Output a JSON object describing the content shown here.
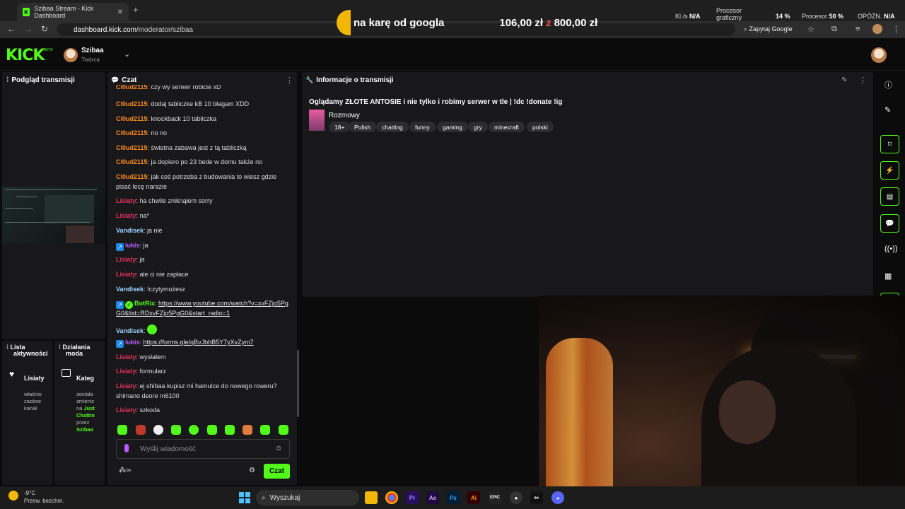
{
  "browser": {
    "tab_title": "Szibaa Stream - Kick Dashboard",
    "tab_close": "✕",
    "new_tab": "+",
    "url_host": "dashboard.kick.com",
    "url_path": "/moderator/szibaa",
    "ask_google": "Zapytaj Google"
  },
  "overlay_banner": {
    "text": "na karę od googla",
    "amount_current": "106,00 zł",
    "separator": "z",
    "amount_goal": "800,00 zł"
  },
  "system_stats": {
    "kls_label": "Kl./s",
    "kls_value": "N/A",
    "gpu_label_1": "Procesor",
    "gpu_label_2": "graficzny",
    "gpu_value": "14 %",
    "cpu_label": "Procesor",
    "cpu_value": "50 %",
    "delay_label": "OPÓŹN.",
    "delay_value": "N/A"
  },
  "header": {
    "logo": "KICK",
    "beta": "BETA",
    "channel_name": "Szibaa",
    "channel_role": "Twórca"
  },
  "preview_panel": {
    "title": "Podgląd transmisji"
  },
  "activity_panel": {
    "title_1": "Lista",
    "title_2": "aktywności",
    "event_name": "Lisiaty",
    "event_text_1": "właśnie",
    "event_text_2": "zaobse",
    "event_text_3": "kanał"
  },
  "mod_panel": {
    "title_1": "Działania",
    "title_2": "moda",
    "event_name": "Kateg",
    "event_text_1": "została",
    "event_text_2": "zmienic",
    "event_text_3": "na",
    "category_1": "Just",
    "category_2": "Chattin",
    "by_text": "przez",
    "by_user": "Szibaa"
  },
  "chat": {
    "title": "Czat",
    "messages": [
      {
        "user": "Cl0ud2115",
        "text": ": czy wy serwer robicie xD"
      },
      {
        "user": "Cl0ud2115",
        "text": ": dodaj tabliczke kB 10 błagam XDD"
      },
      {
        "user": "Cl0ud2115",
        "text": ": knockback 10 tabliczka"
      },
      {
        "user": "Cl0ud2115",
        "text": ": no no"
      },
      {
        "user": "Cl0ud2115",
        "text": ": świetna zabawa jest z tą tabliczką"
      },
      {
        "user": "Cl0ud2115",
        "text": ": ja dopiero po 23 bede w domu także no"
      },
      {
        "user": "Cl0ud2115",
        "text": ": jak coś potrzeba z budowania to wiesz gdzie pisać lecę narazie"
      },
      {
        "user": "Lisiaty",
        "text": ": ha chwile zniknąłem sorry"
      },
      {
        "user": "Lisiaty",
        "text": ": na*"
      },
      {
        "user": "Vandisek",
        "text": ": ja nie"
      },
      {
        "user": "lukis",
        "text": ": ja"
      },
      {
        "user": "Lisiaty",
        "text": ": ja"
      },
      {
        "user": "Lisiaty",
        "text": ": ale ci nie zapłace"
      },
      {
        "user": "Vandisek",
        "text": ": !czytymożesz"
      },
      {
        "user": "BotRix",
        "text": ": ",
        "link": "https://www.youtube.com/watch?v=xvFZjo5PgG0&list=RDxvFZjo5PgG0&start_radio=1"
      },
      {
        "user": "Vandisek",
        "text": ": "
      },
      {
        "user": "lukis",
        "text": ": ",
        "link": "https://forms.gle/qBvJbhB5Y7yXvZym7"
      },
      {
        "user": "Lisiaty",
        "text": ": wysłałem"
      },
      {
        "user": "Lisiaty",
        "text": ": formularz"
      },
      {
        "user": "Lisiaty",
        "text": ": ej shibaa kupisz mi hamulce do nowego roweru? shimano deore m6100"
      },
      {
        "user": "Lisiaty",
        "text": ": szkoda"
      }
    ],
    "input_placeholder": "Wyślij wiadomość",
    "send_label": "Czat"
  },
  "stream_info": {
    "title": "Informacje o transmisji",
    "stream_title": "Oglądamy ZŁOTE ANTOSIE i nie tylko i robimy serwer w tle | !dc !donate !ig",
    "category": "Rozmowy",
    "tags": [
      "18+",
      "Polish",
      "chatting",
      "funny",
      "gaming",
      "gry",
      "minecraft",
      "polski"
    ]
  },
  "taskbar": {
    "temperature": "-9°C",
    "weather": "Przew. bezchm.",
    "search": "Wyszukaj"
  },
  "colors": {
    "kick_green": "#53fc18",
    "panel_bg": "#18181b",
    "page_bg": "#0b0b0c"
  }
}
